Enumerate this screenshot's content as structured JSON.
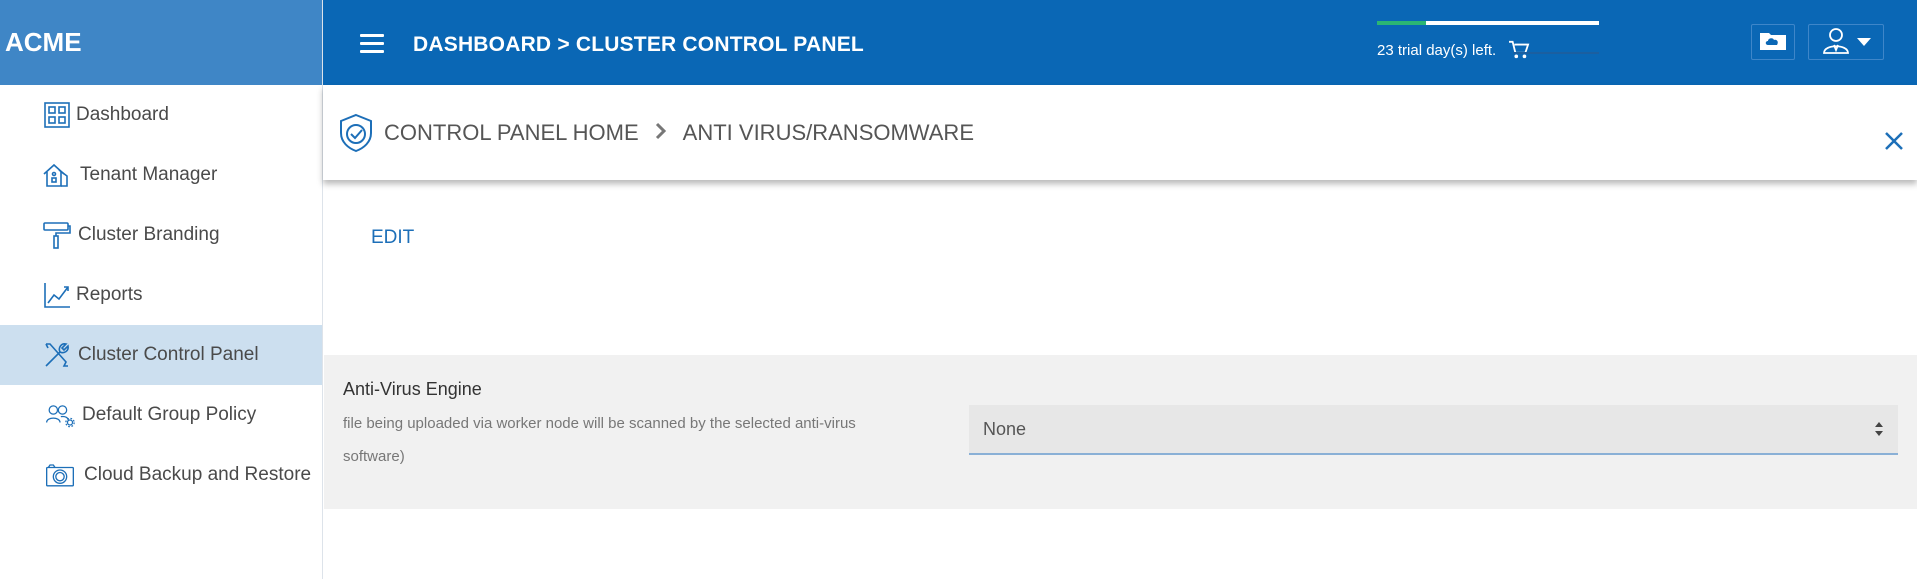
{
  "brand": "ACME",
  "sidebar": {
    "items": [
      {
        "label": "Dashboard",
        "icon": "dashboard-grid-icon"
      },
      {
        "label": "Tenant Manager",
        "icon": "buildings-icon"
      },
      {
        "label": "Cluster Branding",
        "icon": "paint-roller-icon"
      },
      {
        "label": "Reports",
        "icon": "line-chart-icon"
      },
      {
        "label": "Cluster Control Panel",
        "icon": "tools-icon",
        "active": true
      },
      {
        "label": "Default Group Policy",
        "icon": "group-settings-icon"
      },
      {
        "label": "Cloud Backup and Restore",
        "icon": "camera-icon"
      }
    ]
  },
  "header": {
    "breadcrumb": "DASHBOARD > CLUSTER CONTROL PANEL",
    "trial_text": "23 trial day(s) left.",
    "trial_progress": 0.22
  },
  "subheader": {
    "crumb_home": "CONTROL PANEL HOME",
    "crumb_current": "ANTI VIRUS/RANSOMWARE"
  },
  "content": {
    "edit_label": "EDIT",
    "field": {
      "label": "Anti-Virus Engine",
      "description": "file being uploaded via worker node will be scanned by the selected anti-virus software)",
      "value": "None"
    }
  },
  "colors": {
    "header_bg": "#0a67b5",
    "brand_bg": "#3f86c6",
    "active_bg": "#ccdfef",
    "accent": "#1d6fb8",
    "progress": "#2bb673"
  }
}
